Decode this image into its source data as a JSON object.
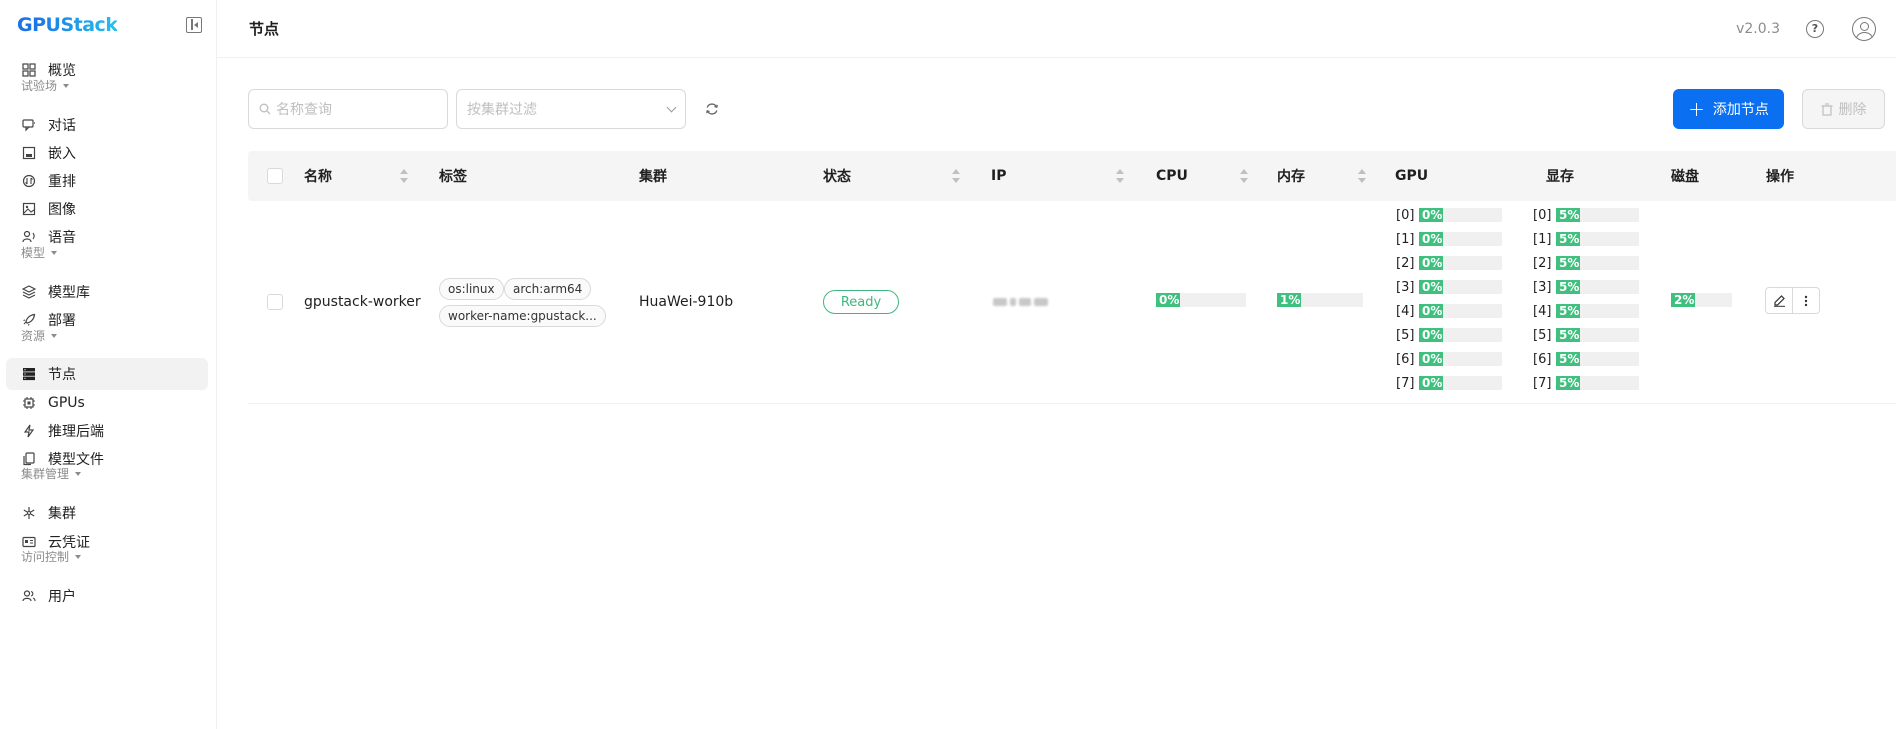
{
  "app": {
    "logo": "GPUStack",
    "logo_first": "G",
    "logo_rest": "PUStack",
    "version": "v2.0.3"
  },
  "sidebar": {
    "items": [
      {
        "key": "overview",
        "label": "概览",
        "icon": "grid-icon"
      },
      {
        "key": "playground",
        "label": "试验场",
        "group": true
      },
      {
        "key": "chat",
        "label": "对话",
        "icon": "chat-icon"
      },
      {
        "key": "embed",
        "label": "嵌入",
        "icon": "embed-icon"
      },
      {
        "key": "rerank",
        "label": "重排",
        "icon": "rerank-icon"
      },
      {
        "key": "image",
        "label": "图像",
        "icon": "image-icon"
      },
      {
        "key": "audio",
        "label": "语音",
        "icon": "audio-icon"
      },
      {
        "key": "models-group",
        "label": "模型",
        "group": true
      },
      {
        "key": "catalog",
        "label": "模型库",
        "icon": "layers-icon"
      },
      {
        "key": "deploy",
        "label": "部署",
        "icon": "rocket-icon"
      },
      {
        "key": "resources",
        "label": "资源",
        "group": true
      },
      {
        "key": "nodes",
        "label": "节点",
        "icon": "server-icon",
        "active": true
      },
      {
        "key": "gpus",
        "label": "GPUs",
        "icon": "chip-icon"
      },
      {
        "key": "backends",
        "label": "推理后端",
        "icon": "bolt-icon"
      },
      {
        "key": "model-files",
        "label": "模型文件",
        "icon": "files-icon"
      },
      {
        "key": "cluster-mgmt",
        "label": "集群管理",
        "group": true
      },
      {
        "key": "clusters",
        "label": "集群",
        "icon": "cluster-icon"
      },
      {
        "key": "credentials",
        "label": "云凭证",
        "icon": "credential-icon"
      },
      {
        "key": "access",
        "label": "访问控制",
        "group": true
      },
      {
        "key": "users",
        "label": "用户",
        "icon": "users-icon"
      }
    ]
  },
  "header": {
    "title": "节点"
  },
  "toolbar": {
    "search_placeholder": "名称查询",
    "cluster_filter_placeholder": "按集群过滤",
    "add_label": "添加节点",
    "delete_label": "删除"
  },
  "table": {
    "columns": [
      "名称",
      "标签",
      "集群",
      "状态",
      "IP",
      "CPU",
      "内存",
      "GPU",
      "显存",
      "磁盘",
      "操作"
    ],
    "rows": [
      {
        "name": "gpustack-worker",
        "labels": [
          "os:linux",
          "arch:arm64",
          "worker-name:gpustack..."
        ],
        "cluster": "HuaWei-910b",
        "status": "Ready",
        "cpu": {
          "label": "0%",
          "value": 0
        },
        "memory": {
          "label": "1%",
          "value": 1
        },
        "gpu": [
          {
            "index": "[0]",
            "label": "0%",
            "value": 0
          },
          {
            "index": "[1]",
            "label": "0%",
            "value": 0
          },
          {
            "index": "[2]",
            "label": "0%",
            "value": 0
          },
          {
            "index": "[3]",
            "label": "0%",
            "value": 0
          },
          {
            "index": "[4]",
            "label": "0%",
            "value": 0
          },
          {
            "index": "[5]",
            "label": "0%",
            "value": 0
          },
          {
            "index": "[6]",
            "label": "0%",
            "value": 0
          },
          {
            "index": "[7]",
            "label": "0%",
            "value": 0
          }
        ],
        "vram": [
          {
            "index": "[0]",
            "label": "5%",
            "value": 5
          },
          {
            "index": "[1]",
            "label": "5%",
            "value": 5
          },
          {
            "index": "[2]",
            "label": "5%",
            "value": 5
          },
          {
            "index": "[3]",
            "label": "5%",
            "value": 5
          },
          {
            "index": "[4]",
            "label": "5%",
            "value": 5
          },
          {
            "index": "[5]",
            "label": "5%",
            "value": 5
          },
          {
            "index": "[6]",
            "label": "5%",
            "value": 5
          },
          {
            "index": "[7]",
            "label": "5%",
            "value": 5
          }
        ],
        "disk": {
          "label": "2%",
          "value": 2
        }
      }
    ]
  },
  "colors": {
    "primary": "#0a6ff0",
    "success": "#3fb67e",
    "bar_fill": "#3fc07f"
  }
}
